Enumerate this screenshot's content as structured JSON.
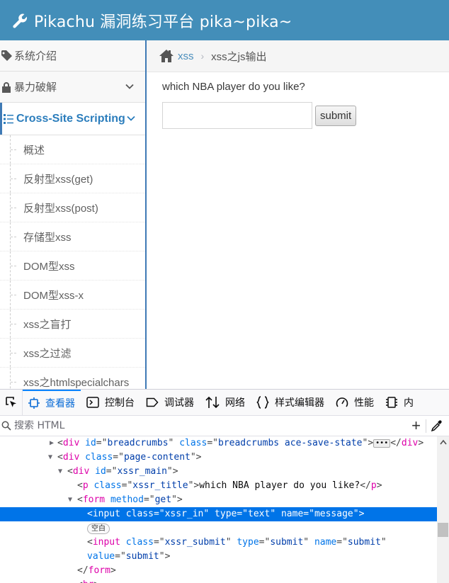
{
  "header": {
    "title": "Pikachu 漏洞练习平台 pika~pika~"
  },
  "sidebar": {
    "items": [
      {
        "label": "系统介绍"
      },
      {
        "label": "暴力破解"
      },
      {
        "label": "Cross-Site Scripting"
      }
    ],
    "sub_items": [
      "概述",
      "反射型xss(get)",
      "反射型xss(post)",
      "存储型xss",
      "DOM型xss",
      "DOM型xss-x",
      "xss之盲打",
      "xss之过滤",
      "xss之htmlspecialchars"
    ]
  },
  "breadcrumbs": {
    "home": "xss",
    "current": "xss之js输出"
  },
  "main": {
    "question": "which NBA player do you like?",
    "submit_label": "submit",
    "input_value": ""
  },
  "devtools": {
    "tabs": [
      "查看器",
      "控制台",
      "调试器",
      "网络",
      "样式编辑器",
      "性能",
      "内"
    ],
    "search_placeholder": "搜索 HTML",
    "whitespace_badge": "空白",
    "colors": {
      "active_tab": "#0a84ff",
      "selection": "#0074e8",
      "tag": "#dd00a9",
      "attr": "#0074e8",
      "value": "#003eaa"
    }
  },
  "colors": {
    "navbar": "#438eb9",
    "sidebar_active": "#2b7dbc"
  }
}
